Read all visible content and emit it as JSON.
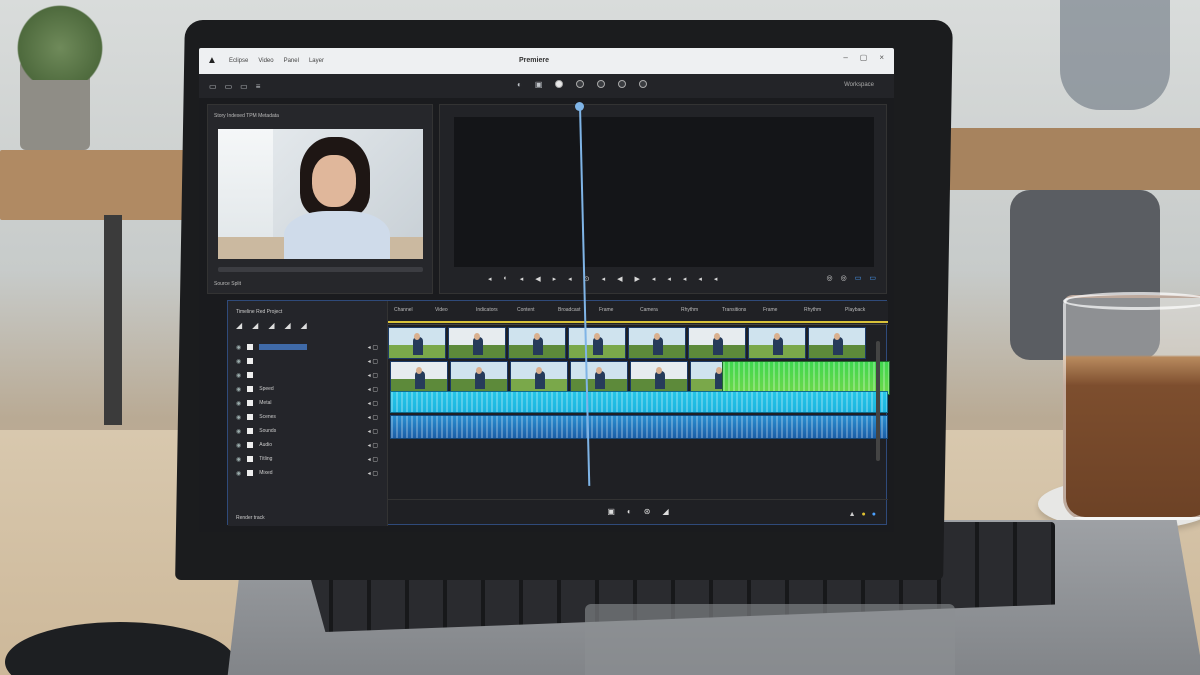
{
  "app": {
    "window_title": "Premiere",
    "menus": [
      "Eclipse",
      "Video",
      "Panel",
      "Layer"
    ],
    "window_controls": [
      "–",
      "▢",
      "×"
    ]
  },
  "toolbar": {
    "left_icons": [
      "file-icon",
      "folder-icon",
      "export-icon",
      "menu-icon"
    ],
    "center_icons": [
      "brush-icon",
      "crop-icon",
      "dot-icon",
      "dot-icon",
      "record-icon",
      "circle-icon",
      "circle-icon"
    ],
    "right_label": "Workspace"
  },
  "source_panel": {
    "title": "Story Indexed TPM Metadata",
    "footer_label": "Source Split"
  },
  "program_panel": {
    "controls": [
      "◂",
      "◐",
      "◂",
      "◀",
      "▸",
      "◂",
      "⊙",
      "◂",
      "◀",
      "▶",
      "◂",
      "◂",
      "◂",
      "◂",
      "◂"
    ],
    "right_controls": [
      "◎",
      "◎",
      "▭",
      "▭"
    ]
  },
  "timeline": {
    "title": "Timeline Red Project",
    "ruler": [
      "Channel",
      "Video",
      "Indicators",
      "Content",
      "Broadcast",
      "Frame",
      "Camera",
      "Rhythm",
      "Transitions",
      "Frame",
      "Rhythm",
      "Playback"
    ],
    "tracks": [
      {
        "name": ""
      },
      {
        "name": ""
      },
      {
        "name": ""
      },
      {
        "name": "Speed"
      },
      {
        "name": "Metal"
      },
      {
        "name": "Scenes"
      },
      {
        "name": "Sounds"
      },
      {
        "name": "Audio"
      },
      {
        "name": "Titling"
      },
      {
        "name": "Mixed"
      }
    ],
    "footer_icons": [
      "save-icon",
      "mask-icon",
      "loop-icon",
      "audio-icon"
    ],
    "status": "Render track"
  },
  "colors": {
    "accent": "#7fb4e6",
    "audio_green": "#3fd74e",
    "audio_cyan": "#25c6e8",
    "audio_blue": "#2a8fd0",
    "ruler_yellow": "#d9c23a"
  }
}
